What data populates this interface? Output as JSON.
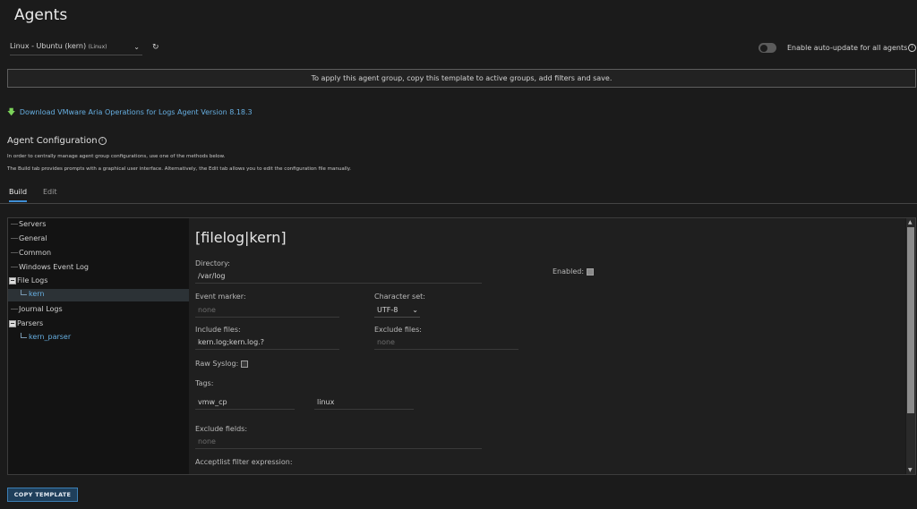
{
  "page": {
    "title": "Agents"
  },
  "group_select": {
    "value": "Linux - Ubuntu (kern)",
    "suffix": "(Linux)"
  },
  "auto_update": {
    "label": "Enable auto-update for all agents",
    "enabled": false
  },
  "banner": {
    "text": "To apply this agent group, copy this template to active groups, add filters and save."
  },
  "download": {
    "link_text": "Download VMware Aria Operations for Logs Agent Version 8.18.3"
  },
  "agent_config": {
    "title": "Agent Configuration",
    "desc1": "In order to centrally manage agent group configurations, use one of the methods below.",
    "desc2": "The Build tab provides prompts with a graphical user interface. Alternatively, the Edit tab allows you to edit the configuration file manually."
  },
  "tabs": [
    {
      "label": "Build",
      "active": true
    },
    {
      "label": "Edit",
      "active": false
    }
  ],
  "tree": {
    "servers": "Servers",
    "general": "General",
    "common": "Common",
    "windows_event_log": "Windows Event Log",
    "file_logs": "File Logs",
    "kern": "kern",
    "journal_logs": "Journal Logs",
    "parsers": "Parsers",
    "kern_parser": "kern_parser"
  },
  "form": {
    "title": "[filelog|kern]",
    "directory_label": "Directory:",
    "directory_value": "/var/log",
    "enabled_label": "Enabled:",
    "enabled": true,
    "event_marker_label": "Event marker:",
    "event_marker_placeholder": "none",
    "charset_label": "Character set:",
    "charset_value": "UTF-8",
    "include_files_label": "Include files:",
    "include_files_value": "kern.log;kern.log.?",
    "exclude_files_label": "Exclude files:",
    "exclude_files_placeholder": "none",
    "raw_syslog_label": "Raw Syslog:",
    "raw_syslog": false,
    "tags_label": "Tags:",
    "tag_key": "vmw_cp",
    "tag_value": "linux",
    "exclude_fields_label": "Exclude fields:",
    "exclude_fields_placeholder": "none",
    "acceptlist_label": "Acceptlist filter expression:"
  },
  "copy_button": {
    "label": "COPY TEMPLATE"
  },
  "colors": {
    "accent": "#3f8ed5",
    "link": "#66aee0",
    "background": "#1b1b1b",
    "download_arrow": "#7bd35a"
  }
}
